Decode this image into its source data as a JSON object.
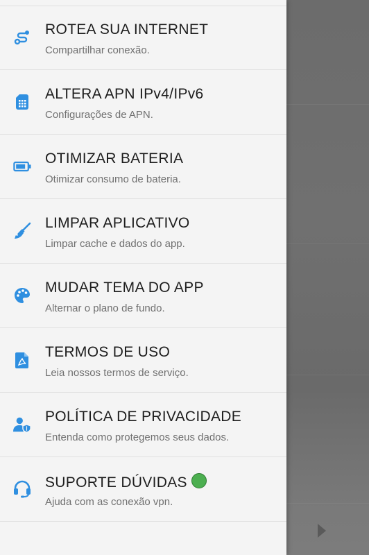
{
  "menu": {
    "items": [
      {
        "id": "tethering",
        "icon": "route-icon",
        "title": "ROTEA SUA INTERNET",
        "subtitle": "Compartilhar conexão."
      },
      {
        "id": "apn",
        "icon": "sim-card-icon",
        "title": "ALTERA APN IPv4/IPv6",
        "subtitle": "Configurações de APN."
      },
      {
        "id": "battery",
        "icon": "battery-icon",
        "title": "OTIMIZAR BATERIA",
        "subtitle": "Otimizar consumo de bateria."
      },
      {
        "id": "clean",
        "icon": "broom-icon",
        "title": "LIMPAR APLICATIVO",
        "subtitle": "Limpar cache e dados do app."
      },
      {
        "id": "theme",
        "icon": "palette-icon",
        "title": "MUDAR TEMA DO APP",
        "subtitle": "Alternar o plano de fundo."
      },
      {
        "id": "terms",
        "icon": "pdf-document-icon",
        "title": "TERMOS DE USO",
        "subtitle": "Leia nossos termos de serviço."
      },
      {
        "id": "privacy",
        "icon": "user-shield-icon",
        "title": "POLÍTICA DE PRIVACIDADE",
        "subtitle": "Entenda como protegemos seus dados."
      },
      {
        "id": "support",
        "icon": "headset-icon",
        "title": "SUPORTE DÚVIDAS",
        "subtitle": "Ajuda com as conexão vpn.",
        "status_icon": "green-circle"
      }
    ]
  },
  "colors": {
    "icon": "#2f8fe0",
    "status_green": "#4caf50"
  }
}
